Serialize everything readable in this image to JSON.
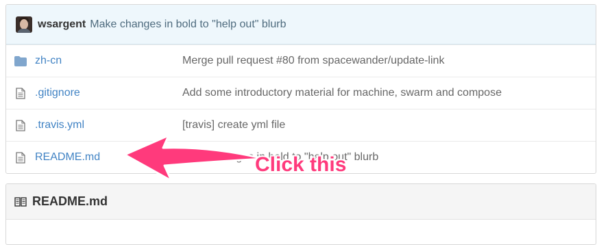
{
  "latest_commit": {
    "author": "wsargent",
    "message": "Make changes in bold to \"help out\" blurb"
  },
  "files": [
    {
      "icon": "folder-icon",
      "name": "zh-cn",
      "message": "Merge pull request #80 from spacewander/update-link"
    },
    {
      "icon": "file-icon",
      "name": ".gitignore",
      "message": "Add some introductory material for machine, swarm and compose"
    },
    {
      "icon": "file-icon",
      "name": ".travis.yml",
      "message": "[travis] create yml file"
    },
    {
      "icon": "file-icon",
      "name": "README.md",
      "message": "Make changes in bold to \"help out\" blurb"
    }
  ],
  "readme": {
    "icon": "book-icon",
    "title": "README.md"
  },
  "annotation": {
    "text": "Click this",
    "color": "#ff3a7c"
  },
  "colors": {
    "link": "#4183c4",
    "commit_bar": "#eef7fc",
    "folder": "#80a6cd"
  }
}
